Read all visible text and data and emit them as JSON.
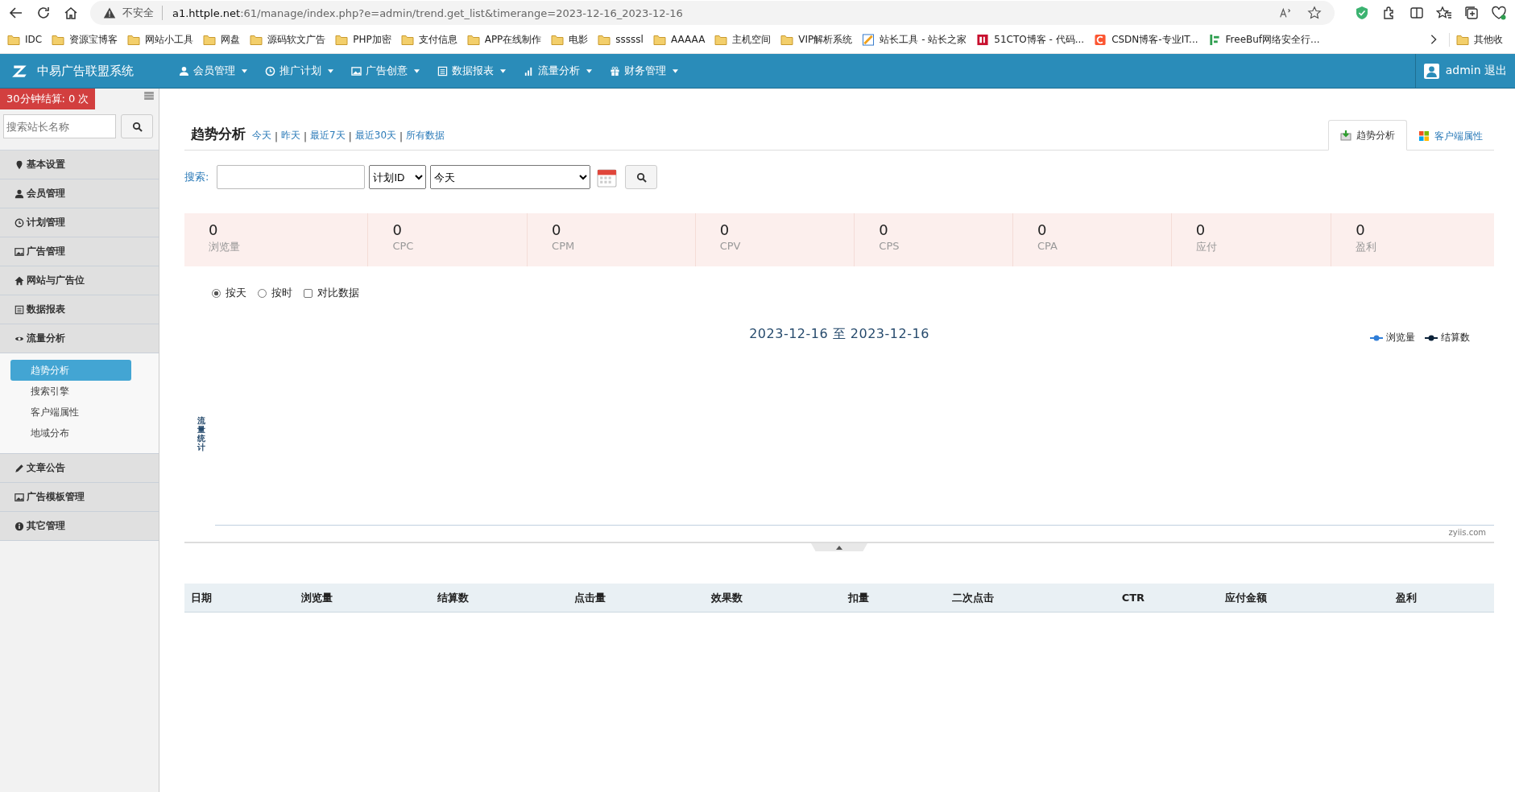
{
  "browser": {
    "security": "不安全",
    "url_host": "a1.httple.net",
    "url_rest": ":61/manage/index.php?e=admin/trend.get_list&timerange=2023-12-16_2023-12-16",
    "bookmarks": [
      {
        "label": "IDC",
        "kind": "folder"
      },
      {
        "label": "资源宝博客",
        "kind": "folder"
      },
      {
        "label": "网站小工具",
        "kind": "folder"
      },
      {
        "label": "网盘",
        "kind": "folder"
      },
      {
        "label": "源码软文广告",
        "kind": "folder"
      },
      {
        "label": "PHP加密",
        "kind": "folder"
      },
      {
        "label": "支付信息",
        "kind": "folder"
      },
      {
        "label": "APP在线制作",
        "kind": "folder"
      },
      {
        "label": "电影",
        "kind": "folder"
      },
      {
        "label": "sssssl",
        "kind": "folder"
      },
      {
        "label": "AAAAA",
        "kind": "folder"
      },
      {
        "label": "主机空间",
        "kind": "folder"
      },
      {
        "label": "VIP解析系统",
        "kind": "folder"
      },
      {
        "label": "站长工具 - 站长之家",
        "kind": "chinaz"
      },
      {
        "label": "51CTO博客 - 代码...",
        "kind": "cto"
      },
      {
        "label": "CSDN博客-专业IT...",
        "kind": "csdn"
      },
      {
        "label": "FreeBuf网络安全行...",
        "kind": "freebuf"
      }
    ],
    "other_folder": "其他收"
  },
  "nav": {
    "brand": "中易广告联盟系统",
    "menus": [
      "会员管理",
      "推广计划",
      "广告创意",
      "数据报表",
      "流量分析",
      "财务管理"
    ],
    "user": "admin 退出"
  },
  "sidebar": {
    "badge": "30分钟结算: 0 次",
    "search": {
      "placeholder": "搜索站长名称"
    },
    "sections": [
      {
        "label": "基本设置"
      },
      {
        "label": "会员管理"
      },
      {
        "label": "计划管理"
      },
      {
        "label": "广告管理"
      },
      {
        "label": "网站与广告位"
      },
      {
        "label": "数据报表"
      },
      {
        "label": "流量分析",
        "expanded": true,
        "children": [
          {
            "label": "趋势分析",
            "selected": true
          },
          {
            "label": "搜索引擎",
            "selected": false
          },
          {
            "label": "客户端属性",
            "selected": false
          },
          {
            "label": "地域分布",
            "selected": false
          }
        ]
      },
      {
        "label": "文章公告"
      },
      {
        "label": "广告模板管理"
      },
      {
        "label": "其它管理"
      }
    ]
  },
  "page": {
    "title": "趋势分析",
    "separator": "|",
    "quick_links": [
      "今天",
      "昨天",
      "最近7天",
      "最近30天",
      "所有数据"
    ],
    "tabs": [
      {
        "label": "趋势分析",
        "selected": true
      },
      {
        "label": "客户端属性",
        "selected": false
      }
    ]
  },
  "search": {
    "label": "搜索:",
    "field_select": "计划ID",
    "range_select": "今天"
  },
  "stats": [
    {
      "value": "0",
      "label": "浏览量"
    },
    {
      "value": "0",
      "label": "CPC"
    },
    {
      "value": "0",
      "label": "CPM"
    },
    {
      "value": "0",
      "label": "CPV"
    },
    {
      "value": "0",
      "label": "CPS"
    },
    {
      "value": "0",
      "label": "CPA"
    },
    {
      "value": "0",
      "label": "应付"
    },
    {
      "value": "0",
      "label": "盈利"
    }
  ],
  "options": [
    {
      "kind": "radio",
      "label": "按天",
      "checked": true
    },
    {
      "kind": "radio",
      "label": "按时",
      "checked": false
    },
    {
      "kind": "checkbox",
      "label": "对比数据",
      "checked": false
    }
  ],
  "chart": {
    "title": "2023-12-16 至 2023-12-16",
    "y_label": "流量统计",
    "credit": "zyiis.com",
    "legend": [
      {
        "name": "浏览量",
        "color": "#2f7ed8"
      },
      {
        "name": "结算数",
        "color": "#0d233a"
      }
    ]
  },
  "table": {
    "columns": [
      "日期",
      "浏览量",
      "结算数",
      "点击量",
      "效果数",
      "扣量",
      "二次点击",
      "CTR",
      "应付金额",
      "盈利"
    ]
  }
}
